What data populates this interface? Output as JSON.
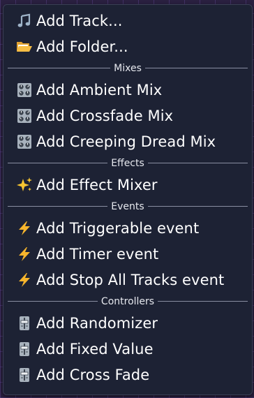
{
  "menu": {
    "track": {
      "label": "Add Track...",
      "icon": "music-note-icon"
    },
    "folder": {
      "label": "Add Folder...",
      "icon": "folder-icon"
    },
    "mixes_header": "Mixes",
    "ambient_mix": {
      "label": "Add Ambient Mix",
      "icon": "control-knobs-icon"
    },
    "crossfade_mix": {
      "label": "Add Crossfade Mix",
      "icon": "control-knobs-icon"
    },
    "creeping_dread_mix": {
      "label": "Add Creeping Dread Mix",
      "icon": "control-knobs-icon"
    },
    "effects_header": "Effects",
    "effect_mixer": {
      "label": "Add Effect Mixer",
      "icon": "sparkles-icon"
    },
    "events_header": "Events",
    "triggerable_event": {
      "label": "Add Triggerable event",
      "icon": "lightning-icon"
    },
    "timer_event": {
      "label": "Add Timer event",
      "icon": "lightning-icon"
    },
    "stop_all_event": {
      "label": "Add Stop All Tracks event",
      "icon": "lightning-icon"
    },
    "controllers_header": "Controllers",
    "randomizer": {
      "label": "Add Randomizer",
      "icon": "level-slider-icon"
    },
    "fixed_value": {
      "label": "Add Fixed Value",
      "icon": "level-slider-icon"
    },
    "cross_fade": {
      "label": "Add Cross Fade",
      "icon": "level-slider-icon"
    }
  }
}
